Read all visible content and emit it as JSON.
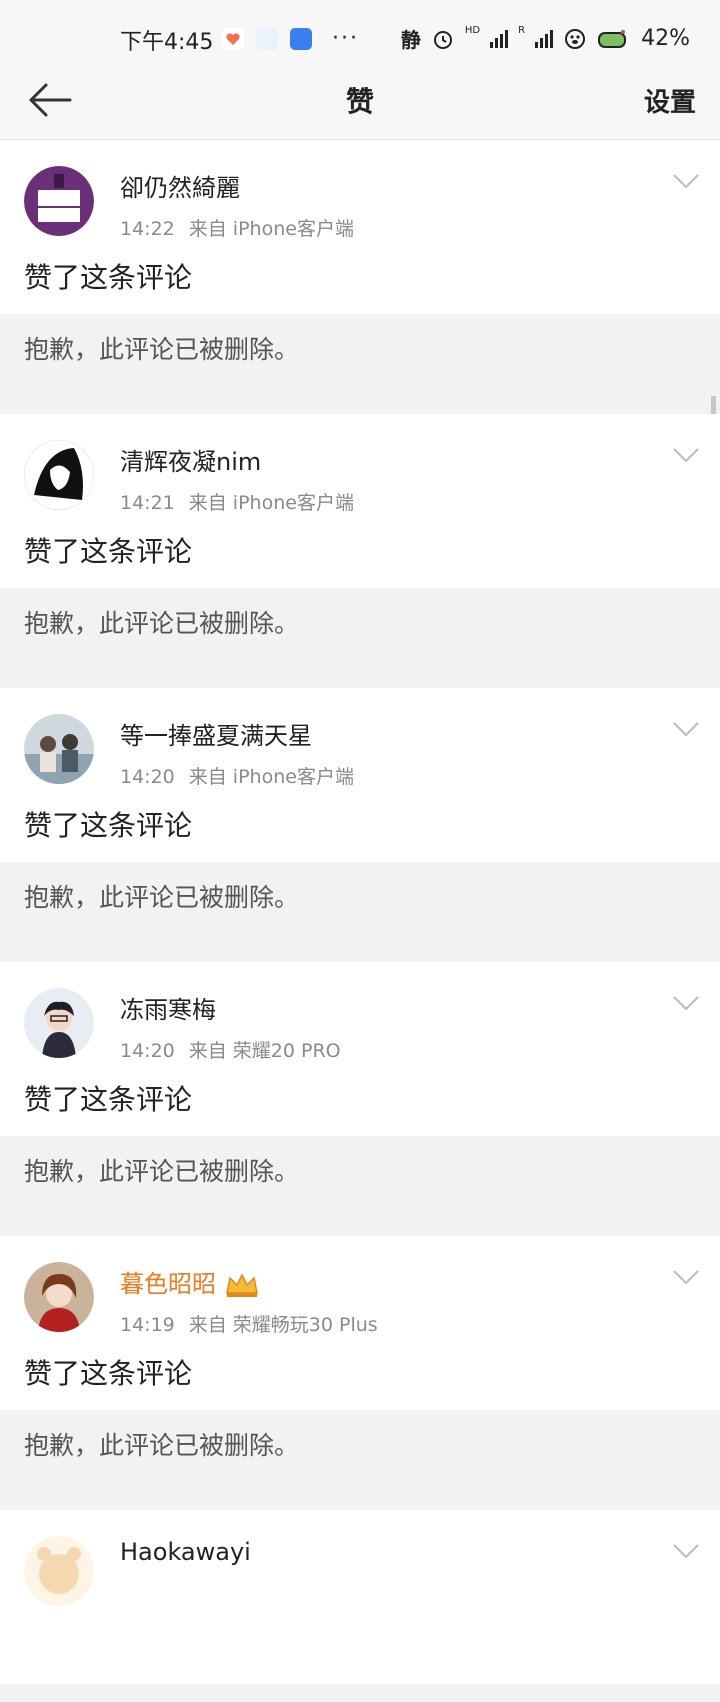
{
  "status_bar": {
    "time": "下午4:45",
    "mode_label": "静",
    "hd_label": "HD",
    "r_label": "R",
    "battery": "42%",
    "more": "···"
  },
  "header": {
    "title": "赞",
    "settings_label": "设置"
  },
  "items": [
    {
      "name": "卻仍然綺麗",
      "time": "14:22",
      "source": "来自 iPhone客户端",
      "action": "赞了这条评论",
      "quote": "抱歉，此评论已被删除。",
      "vip": false
    },
    {
      "name": "清辉夜凝nim",
      "time": "14:21",
      "source": "来自 iPhone客户端",
      "action": "赞了这条评论",
      "quote": "抱歉，此评论已被删除。",
      "vip": false
    },
    {
      "name": "等一捧盛夏满天星",
      "time": "14:20",
      "source": "来自 iPhone客户端",
      "action": "赞了这条评论",
      "quote": "抱歉，此评论已被删除。",
      "vip": false
    },
    {
      "name": "冻雨寒梅",
      "time": "14:20",
      "source": "来自 荣耀20 PRO",
      "action": "赞了这条评论",
      "quote": "抱歉，此评论已被删除。",
      "vip": false
    },
    {
      "name": "暮色昭昭",
      "time": "14:19",
      "source": "来自 荣耀畅玩30 Plus",
      "action": "赞了这条评论",
      "quote": "抱歉，此评论已被删除。",
      "vip": true
    },
    {
      "name": "Haokawayi",
      "time": "",
      "source": "",
      "action": "",
      "quote": "",
      "vip": false
    }
  ],
  "colors": {
    "vip_name": "#f07a1e",
    "meta": "#8a8a8a"
  }
}
